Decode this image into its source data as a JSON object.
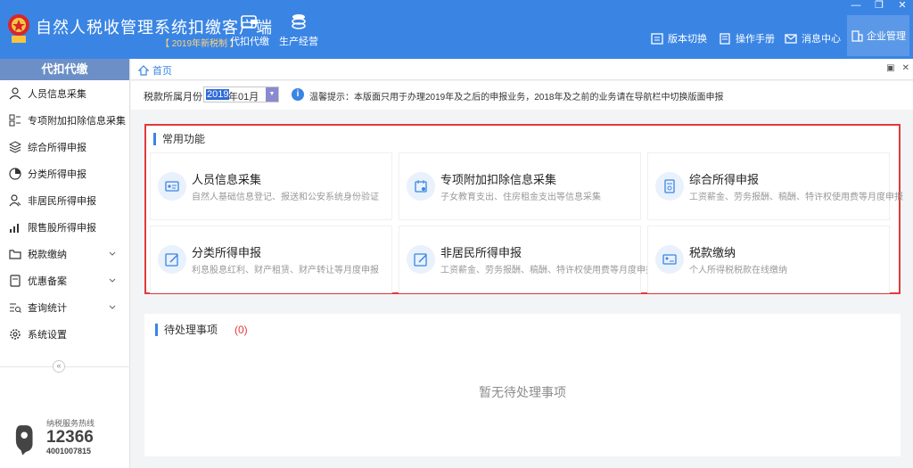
{
  "app": {
    "title": "自然人税收管理系统扣缴客户端",
    "subtitle": "【 2019年新税制 】"
  },
  "top_nav": [
    {
      "label": "代扣代缴",
      "icon": "wallet-icon"
    },
    {
      "label": "生产经营",
      "icon": "coins-icon"
    }
  ],
  "right_nav": [
    {
      "label": "版本切换",
      "icon": "switch-icon"
    },
    {
      "label": "操作手册",
      "icon": "manual-icon"
    },
    {
      "label": "消息中心",
      "icon": "mail-icon"
    },
    {
      "label": "企业管理",
      "icon": "building-icon"
    }
  ],
  "window_controls": {
    "minimize": "—",
    "restore": "❐",
    "close": "✕"
  },
  "sidebar": {
    "header": "代扣代缴",
    "items": [
      {
        "label": "人员信息采集",
        "icon": "person-icon",
        "expandable": false
      },
      {
        "label": "专项附加扣除信息采集",
        "icon": "grid-icon",
        "expandable": true
      },
      {
        "label": "综合所得申报",
        "icon": "layers-icon",
        "expandable": false
      },
      {
        "label": "分类所得申报",
        "icon": "pie-icon",
        "expandable": false
      },
      {
        "label": "非居民所得申报",
        "icon": "person-icon",
        "expandable": false
      },
      {
        "label": "限售股所得申报",
        "icon": "bars-icon",
        "expandable": false
      },
      {
        "label": "税款缴纳",
        "icon": "folder-icon",
        "expandable": true
      },
      {
        "label": "优惠备案",
        "icon": "file-icon",
        "expandable": true
      },
      {
        "label": "查询统计",
        "icon": "list-search-icon",
        "expandable": true
      },
      {
        "label": "系统设置",
        "icon": "gear-icon",
        "expandable": false
      }
    ],
    "collapse": "«",
    "hotline_label": "纳税服务热线",
    "hotline_number": "12366",
    "hotline_alt": "4001007815"
  },
  "breadcrumb": {
    "home": "首页"
  },
  "filter": {
    "label": "税款所属月份",
    "year": "2019",
    "month": "年01月",
    "tip": "温馨提示：本版面只用于办理2019年及之后的申报业务，2018年及之前的业务请在导航栏中切换版面申报"
  },
  "common": {
    "title": "常用功能",
    "cards": [
      {
        "title": "人员信息采集",
        "desc": "自然人基础信息登记、报送和公安系统身份验证",
        "icon": "id-card-icon"
      },
      {
        "title": "专项附加扣除信息采集",
        "desc": "子女教育支出、住房租金支出等信息采集",
        "icon": "calendar-icon"
      },
      {
        "title": "综合所得申报",
        "desc": "工资薪金、劳务报酬、稿酬、特许权使用费等月度申报",
        "icon": "document-icon"
      },
      {
        "title": "分类所得申报",
        "desc": "利息股息红利、财产租赁、财产转让等月度申报",
        "icon": "edit-icon"
      },
      {
        "title": "非居民所得申报",
        "desc": "工资薪金、劳务报酬、稿酬、特许权使用费等月度申报",
        "icon": "edit-icon"
      },
      {
        "title": "税款缴纳",
        "desc": "个人所得税税款在线缴纳",
        "icon": "payment-card-icon"
      }
    ]
  },
  "pending": {
    "title": "待处理事项",
    "count": "(0)",
    "empty": "暂无待处理事项"
  },
  "colors": {
    "primary": "#3a85e4",
    "highlight_border": "#e23a3a",
    "sidebar_header": "#6b8fc6"
  }
}
